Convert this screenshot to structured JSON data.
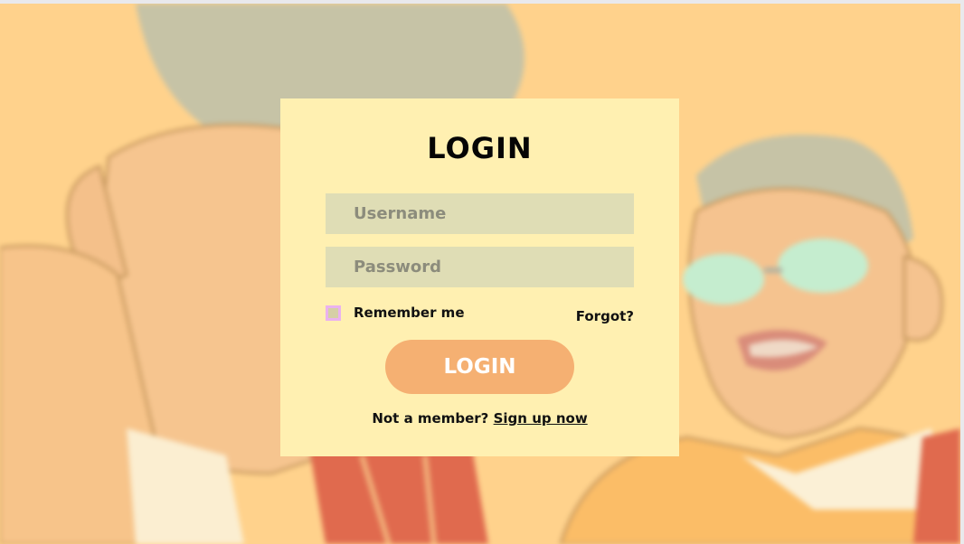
{
  "login_form": {
    "title": "LOGIN",
    "username_placeholder": "Username",
    "password_placeholder": "Password",
    "remember_label": "Remember me",
    "forgot_label": "Forgot?",
    "submit_label": "LOGIN",
    "not_member_text": "Not a member?",
    "signup_label": "Sign up now"
  },
  "colors": {
    "background": "#ffd28c",
    "card": "#fff0b1",
    "input": "#dfddb5",
    "button": "#f5b072",
    "checkbox_border": "#eab2ef"
  }
}
